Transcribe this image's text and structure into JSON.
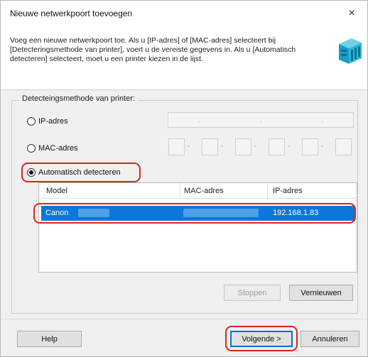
{
  "dialog": {
    "title": "Nieuwe netwerkpoort toevoegen",
    "close_label": "×",
    "description": "Voeg een nieuwe netwerkpoort toe. Als u [IP-adres] of [MAC-adres] selecteert bij [Detecteringsmethode van printer], voert u de vereiste gegevens in. Als u [Automatisch detecteren] selecteert, moet u een printer kiezen in de lijst.",
    "header_icon": "printer-icon"
  },
  "detection": {
    "group_label": "Detecteingsmethode van printer:",
    "ip_label": "IP-adres",
    "mac_label": "MAC-adres",
    "auto_label": "Automatisch detecteren",
    "selected": "auto",
    "ip_separators": [
      ".",
      ".",
      "."
    ],
    "mac_separators": [
      "-",
      "-",
      "-",
      "-",
      "-"
    ]
  },
  "printer_list": {
    "columns": [
      "Model",
      "MAC-adres",
      "IP-adres"
    ],
    "rows": [
      {
        "model": "Canon",
        "mac": "",
        "ip": "192.168.1.83",
        "selected": true
      }
    ]
  },
  "buttons": {
    "stop": "Stoppen",
    "refresh": "Vernieuwen",
    "help": "Help",
    "next": "Volgende >",
    "cancel": "Annuleren"
  },
  "colors": {
    "highlight": "#e0231b",
    "selection": "#0a78d7",
    "default_button_border": "#0b6fd3"
  }
}
